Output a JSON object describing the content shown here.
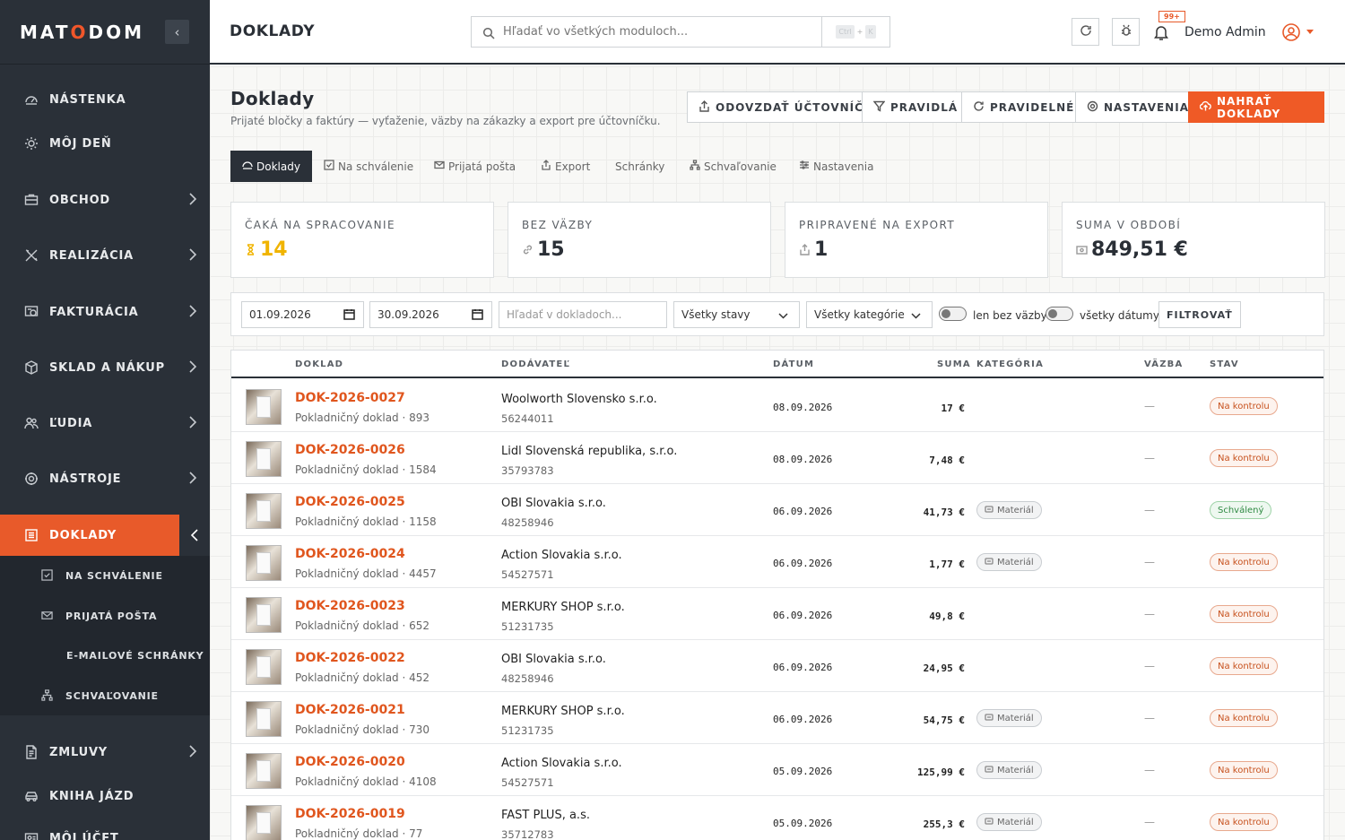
{
  "app": {
    "logo": "MATODOM"
  },
  "sidebar": {
    "items": [
      {
        "label": "NÁSTENKA",
        "icon": "dashboard-icon"
      },
      {
        "label": "MÔJ DEŇ",
        "icon": "sun-icon"
      },
      {
        "label": "OBCHOD",
        "icon": "briefcase-icon"
      },
      {
        "label": "REALIZÁCIA",
        "icon": "tools-icon"
      },
      {
        "label": "FAKTURÁCIA",
        "icon": "invoice-icon"
      },
      {
        "label": "SKLAD A NÁKUP",
        "icon": "box-icon"
      },
      {
        "label": "ĽUDIA",
        "icon": "people-icon"
      },
      {
        "label": "NÁSTROJE",
        "icon": "gear-icon"
      },
      {
        "label": "DOKLADY",
        "icon": "receipt-icon"
      },
      {
        "label": "ZMLUVY",
        "icon": "contract-icon"
      },
      {
        "label": "KNIHA JÁZD",
        "icon": "car-icon"
      },
      {
        "label": "MÔJ ÚČET",
        "icon": "account-icon"
      }
    ],
    "sub_items": [
      {
        "label": "NA SCHVÁLENIE",
        "icon": "check-square-icon"
      },
      {
        "label": "PRIJATÁ POŠTA",
        "icon": "mail-icon"
      },
      {
        "label": "E-MAILOVÉ SCHRÁNKY",
        "icon": ""
      },
      {
        "label": "SCHVAĽOVANIE",
        "icon": "hierarchy-icon"
      }
    ]
  },
  "topbar": {
    "title": "DOKLADY",
    "search_placeholder": "Hľadať vo všetkých moduloch...",
    "kbd": [
      "Ctrl",
      "+",
      "K"
    ],
    "notif_badge": "99+",
    "user_name": "Demo Admin"
  },
  "page": {
    "title": "Doklady",
    "subtitle": "Prijaté bločky a faktúry — vyťaženie, väzby na zákazky a export pre účtovníčku.",
    "actions": [
      "ODOVZDAŤ ÚČTOVNÍČKE",
      "PRAVIDLÁ",
      "PRAVIDELNÉ",
      "NASTAVENIA",
      "NAHRAŤ DOKLADY"
    ]
  },
  "tabs": [
    "Doklady",
    "Na schválenie",
    "Prijatá pošta",
    "Export",
    "Schránky",
    "Schvaľovanie",
    "Nastavenia"
  ],
  "stats": [
    {
      "label": "ČAKÁ NA SPRACOVANIE",
      "value": "14"
    },
    {
      "label": "BEZ VÄZBY",
      "value": "15"
    },
    {
      "label": "PRIPRAVENÉ NA EXPORT",
      "value": "1"
    },
    {
      "label": "SUMA V OBDOBÍ",
      "value": "849,51 €"
    }
  ],
  "filters": {
    "date_from": "01.09.2026",
    "date_to": "30.09.2026",
    "search_placeholder": "Hľadať v dokladoch...",
    "status": "Všetky stavy",
    "category": "Všetky kategórie",
    "toggle1": "len bez väzby",
    "toggle2": "všetky dátumy",
    "button": "FILTROVAŤ"
  },
  "table": {
    "headers": [
      "DOKLAD",
      "DODÁVATEĽ",
      "DÁTUM",
      "SUMA",
      "KATEGÓRIA",
      "VÄZBA",
      "STAV"
    ],
    "rows": [
      {
        "no": "DOK-2026-0027",
        "sub": "Pokladničný doklad · 893",
        "supplier": "Woolworth Slovensko s.r.o.",
        "ico": "56244011",
        "date": "08.09.2026",
        "amount": "17 €",
        "category": "",
        "binding": "—",
        "status": "Na kontrolu"
      },
      {
        "no": "DOK-2026-0026",
        "sub": "Pokladničný doklad · 1584",
        "supplier": "Lidl Slovenská republika, s.r.o.",
        "ico": "35793783",
        "date": "08.09.2026",
        "amount": "7,48 €",
        "category": "",
        "binding": "—",
        "status": "Na kontrolu"
      },
      {
        "no": "DOK-2026-0025",
        "sub": "Pokladničný doklad · 1158",
        "supplier": "OBI Slovakia s.r.o.",
        "ico": "48258946",
        "date": "06.09.2026",
        "amount": "41,73 €",
        "category": "Materiál",
        "binding": "—",
        "status": "Schválený"
      },
      {
        "no": "DOK-2026-0024",
        "sub": "Pokladničný doklad · 4457",
        "supplier": "Action Slovakia s.r.o.",
        "ico": "54527571",
        "date": "06.09.2026",
        "amount": "1,77 €",
        "category": "Materiál",
        "binding": "—",
        "status": "Na kontrolu"
      },
      {
        "no": "DOK-2026-0023",
        "sub": "Pokladničný doklad · 652",
        "supplier": "MERKURY SHOP s.r.o.",
        "ico": "51231735",
        "date": "06.09.2026",
        "amount": "49,8 €",
        "category": "",
        "binding": "—",
        "status": "Na kontrolu"
      },
      {
        "no": "DOK-2026-0022",
        "sub": "Pokladničný doklad · 452",
        "supplier": "OBI Slovakia s.r.o.",
        "ico": "48258946",
        "date": "06.09.2026",
        "amount": "24,95 €",
        "category": "",
        "binding": "—",
        "status": "Na kontrolu"
      },
      {
        "no": "DOK-2026-0021",
        "sub": "Pokladničný doklad · 730",
        "supplier": "MERKURY SHOP s.r.o.",
        "ico": "51231735",
        "date": "06.09.2026",
        "amount": "54,75 €",
        "category": "Materiál",
        "binding": "—",
        "status": "Na kontrolu"
      },
      {
        "no": "DOK-2026-0020",
        "sub": "Pokladničný doklad · 4108",
        "supplier": "Action Slovakia s.r.o.",
        "ico": "54527571",
        "date": "05.09.2026",
        "amount": "125,99 €",
        "category": "Materiál",
        "binding": "—",
        "status": "Na kontrolu"
      },
      {
        "no": "DOK-2026-0019",
        "sub": "Pokladničný doklad · 77",
        "supplier": "FAST PLUS, a.s.",
        "ico": "35712783",
        "date": "05.09.2026",
        "amount": "255,3 €",
        "category": "Materiál",
        "binding": "—",
        "status": "Na kontrolu"
      }
    ]
  }
}
